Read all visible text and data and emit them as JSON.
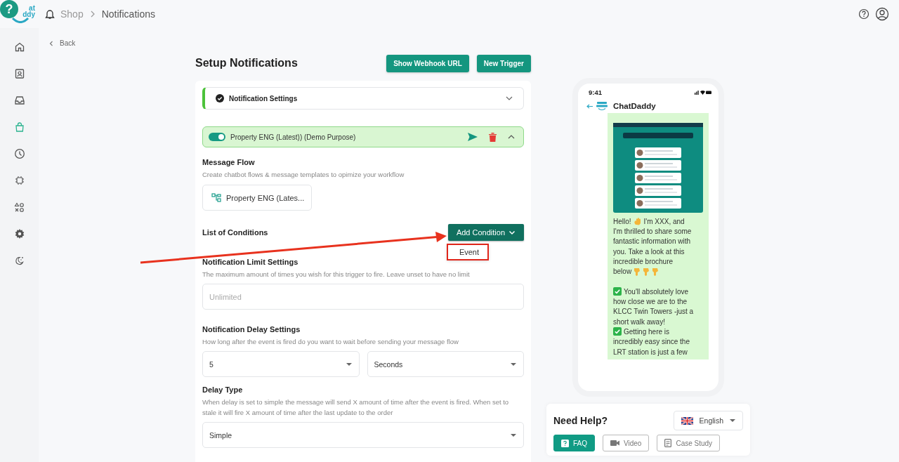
{
  "logo": {
    "line_1": "at",
    "line_2": "ddy"
  },
  "help_bubble": {
    "label": "?"
  },
  "breadcrumb": [
    "Shop",
    "Notifications"
  ],
  "sidebar": {
    "items": [
      {
        "selected": false
      },
      {
        "selected": false
      },
      {
        "selected": false
      },
      {
        "selected": true
      },
      {
        "selected": false
      },
      {
        "selected": false
      },
      {
        "selected": false
      },
      {
        "selected": false
      },
      {
        "selected": false
      }
    ]
  },
  "back": "Back",
  "title": "Setup Notifications",
  "header_buttons": [
    "Show Webhook URL",
    "New Trigger"
  ],
  "settings_section": {
    "title": "Notification Settings",
    "expanded": false
  },
  "trigger": {
    "name": "Property ENG (Latest)) (Demo Purpose)",
    "on": true,
    "expanded": true
  },
  "message_flow": {
    "title": "Message Flow",
    "description": "Create chatbot flows & message templates to opimize your workflow",
    "flow": "Property ENG (Lates..."
  },
  "conditions": {
    "title": "List of Conditions",
    "button": "Add Condition",
    "menu": [
      {
        "label": "Event",
        "highlighted": true
      }
    ],
    "pointer_arrow": true
  },
  "limit": {
    "title": "Notification Limit Settings",
    "description": "The maximum amount of times you wish for this trigger to fire. Leave unset to have no limit",
    "placeholder": "Unlimited"
  },
  "delay": {
    "title": "Notification Delay Settings",
    "description": "How long after the event is fired do you want to wait before sending your message flow",
    "amount": "5",
    "unit": "Seconds"
  },
  "delay_type": {
    "title": "Delay Type",
    "description": "When delay is set to simple the message will send X amount of time after the event is fired. When set to stale it will fire X amount of time after the last update to the order",
    "value": "Simple"
  },
  "phone": {
    "time": "9:41",
    "chat_name": "ChatDaddy",
    "message_lines": [
      [
        {
          "kind": "text",
          "text": "Hello!"
        },
        {
          "kind": "wave"
        },
        {
          "kind": "text",
          "text": "I'm XXX, and"
        }
      ],
      [
        {
          "kind": "text",
          "text": "I'm thrilled to share some"
        }
      ],
      [
        {
          "kind": "text",
          "text": "fantastic information with"
        }
      ],
      [
        {
          "kind": "text",
          "text": "you. Take a look at this"
        }
      ],
      [
        {
          "kind": "text",
          "text": "incredible brochure"
        }
      ],
      [
        {
          "kind": "text",
          "text": "below"
        },
        {
          "kind": "point"
        },
        {
          "kind": "point"
        },
        {
          "kind": "point"
        }
      ],
      [
        {
          "kind": "gap"
        }
      ],
      [
        {
          "kind": "check"
        },
        {
          "kind": "text",
          "text": "You'll absolutely love"
        }
      ],
      [
        {
          "kind": "text",
          "text": "how close we are to the"
        }
      ],
      [
        {
          "kind": "text",
          "text": "KLCC Twin Towers -just a"
        }
      ],
      [
        {
          "kind": "text",
          "text": "short walk away!"
        }
      ],
      [
        {
          "kind": "check"
        },
        {
          "kind": "text",
          "text": "Getting here is"
        }
      ],
      [
        {
          "kind": "text",
          "text": "incredibly easy since the"
        }
      ],
      [
        {
          "kind": "text",
          "text": "LRT station is just a few"
        }
      ]
    ]
  },
  "help": {
    "title": "Need Help?",
    "language": "English",
    "tabs": [
      {
        "label": "FAQ",
        "selected": true
      },
      {
        "label": "Video",
        "selected": false
      },
      {
        "label": "Case Study",
        "selected": false
      }
    ]
  }
}
